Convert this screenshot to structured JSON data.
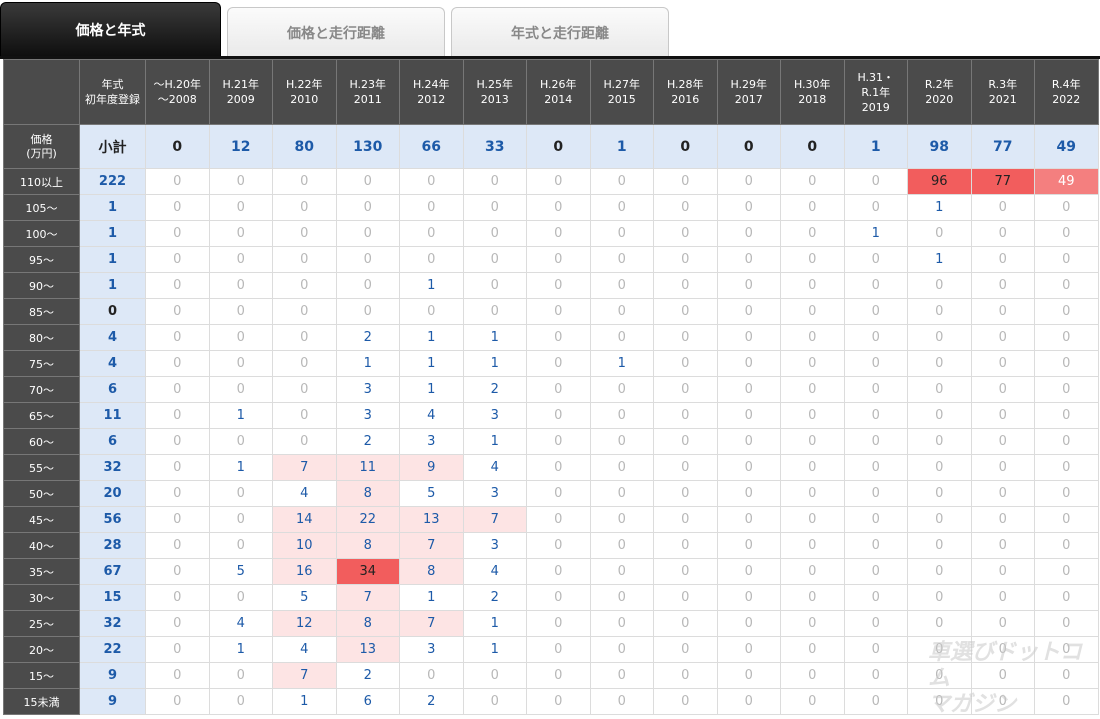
{
  "tabs": [
    {
      "label": "価格と年式",
      "active": true
    },
    {
      "label": "価格と走行距離",
      "active": false
    },
    {
      "label": "年式と走行距離",
      "active": false
    }
  ],
  "header": {
    "corner": "",
    "total_label": "年式\n初年度登録",
    "years": [
      "〜H.20年\n〜2008",
      "H.21年\n2009",
      "H.22年\n2010",
      "H.23年\n2011",
      "H.24年\n2012",
      "H.25年\n2013",
      "H.26年\n2014",
      "H.27年\n2015",
      "H.28年\n2016",
      "H.29年\n2017",
      "H.30年\n2018",
      "H.31・\nR.1年\n2019",
      "R.2年\n2020",
      "R.3年\n2021",
      "R.4年\n2022"
    ]
  },
  "subtotal": {
    "label": "価格\n(万円)",
    "total": "小計",
    "values": [
      0,
      12,
      80,
      130,
      66,
      33,
      0,
      1,
      0,
      0,
      0,
      1,
      98,
      77,
      49
    ]
  },
  "rows": [
    {
      "label": "110以上",
      "total": 222,
      "values": [
        0,
        0,
        0,
        0,
        0,
        0,
        0,
        0,
        0,
        0,
        0,
        0,
        96,
        77,
        49
      ]
    },
    {
      "label": "105〜",
      "total": 1,
      "values": [
        0,
        0,
        0,
        0,
        0,
        0,
        0,
        0,
        0,
        0,
        0,
        0,
        1,
        0,
        0
      ]
    },
    {
      "label": "100〜",
      "total": 1,
      "values": [
        0,
        0,
        0,
        0,
        0,
        0,
        0,
        0,
        0,
        0,
        0,
        1,
        0,
        0,
        0
      ]
    },
    {
      "label": "95〜",
      "total": 1,
      "values": [
        0,
        0,
        0,
        0,
        0,
        0,
        0,
        0,
        0,
        0,
        0,
        0,
        1,
        0,
        0
      ]
    },
    {
      "label": "90〜",
      "total": 1,
      "values": [
        0,
        0,
        0,
        0,
        1,
        0,
        0,
        0,
        0,
        0,
        0,
        0,
        0,
        0,
        0
      ]
    },
    {
      "label": "85〜",
      "total": 0,
      "values": [
        0,
        0,
        0,
        0,
        0,
        0,
        0,
        0,
        0,
        0,
        0,
        0,
        0,
        0,
        0
      ]
    },
    {
      "label": "80〜",
      "total": 4,
      "values": [
        0,
        0,
        0,
        2,
        1,
        1,
        0,
        0,
        0,
        0,
        0,
        0,
        0,
        0,
        0
      ]
    },
    {
      "label": "75〜",
      "total": 4,
      "values": [
        0,
        0,
        0,
        1,
        1,
        1,
        0,
        1,
        0,
        0,
        0,
        0,
        0,
        0,
        0
      ]
    },
    {
      "label": "70〜",
      "total": 6,
      "values": [
        0,
        0,
        0,
        3,
        1,
        2,
        0,
        0,
        0,
        0,
        0,
        0,
        0,
        0,
        0
      ]
    },
    {
      "label": "65〜",
      "total": 11,
      "values": [
        0,
        1,
        0,
        3,
        4,
        3,
        0,
        0,
        0,
        0,
        0,
        0,
        0,
        0,
        0
      ]
    },
    {
      "label": "60〜",
      "total": 6,
      "values": [
        0,
        0,
        0,
        2,
        3,
        1,
        0,
        0,
        0,
        0,
        0,
        0,
        0,
        0,
        0
      ]
    },
    {
      "label": "55〜",
      "total": 32,
      "values": [
        0,
        1,
        7,
        11,
        9,
        4,
        0,
        0,
        0,
        0,
        0,
        0,
        0,
        0,
        0
      ]
    },
    {
      "label": "50〜",
      "total": 20,
      "values": [
        0,
        0,
        4,
        8,
        5,
        3,
        0,
        0,
        0,
        0,
        0,
        0,
        0,
        0,
        0
      ]
    },
    {
      "label": "45〜",
      "total": 56,
      "values": [
        0,
        0,
        14,
        22,
        13,
        7,
        0,
        0,
        0,
        0,
        0,
        0,
        0,
        0,
        0
      ]
    },
    {
      "label": "40〜",
      "total": 28,
      "values": [
        0,
        0,
        10,
        8,
        7,
        3,
        0,
        0,
        0,
        0,
        0,
        0,
        0,
        0,
        0
      ]
    },
    {
      "label": "35〜",
      "total": 67,
      "values": [
        0,
        5,
        16,
        34,
        8,
        4,
        0,
        0,
        0,
        0,
        0,
        0,
        0,
        0,
        0
      ]
    },
    {
      "label": "30〜",
      "total": 15,
      "values": [
        0,
        0,
        5,
        7,
        1,
        2,
        0,
        0,
        0,
        0,
        0,
        0,
        0,
        0,
        0
      ]
    },
    {
      "label": "25〜",
      "total": 32,
      "values": [
        0,
        4,
        12,
        8,
        7,
        1,
        0,
        0,
        0,
        0,
        0,
        0,
        0,
        0,
        0
      ]
    },
    {
      "label": "20〜",
      "total": 22,
      "values": [
        0,
        1,
        4,
        13,
        3,
        1,
        0,
        0,
        0,
        0,
        0,
        0,
        0,
        0,
        0
      ]
    },
    {
      "label": "15〜",
      "total": 9,
      "values": [
        0,
        0,
        7,
        2,
        0,
        0,
        0,
        0,
        0,
        0,
        0,
        0,
        0,
        0,
        0
      ]
    },
    {
      "label": "15未満",
      "total": 9,
      "values": [
        0,
        0,
        1,
        6,
        2,
        0,
        0,
        0,
        0,
        0,
        0,
        0,
        0,
        0,
        0
      ]
    }
  ],
  "watermark": "車選びドットコム\nマガジン",
  "colors": {
    "header_bg": "#4b4b4b",
    "subtotal_bg": "#dde8f7",
    "value_blue": "#1d5aa8",
    "heat_light": "#fde4e4",
    "heat_mid": "#f9b8b8",
    "heat_high": "#f25d5d"
  }
}
